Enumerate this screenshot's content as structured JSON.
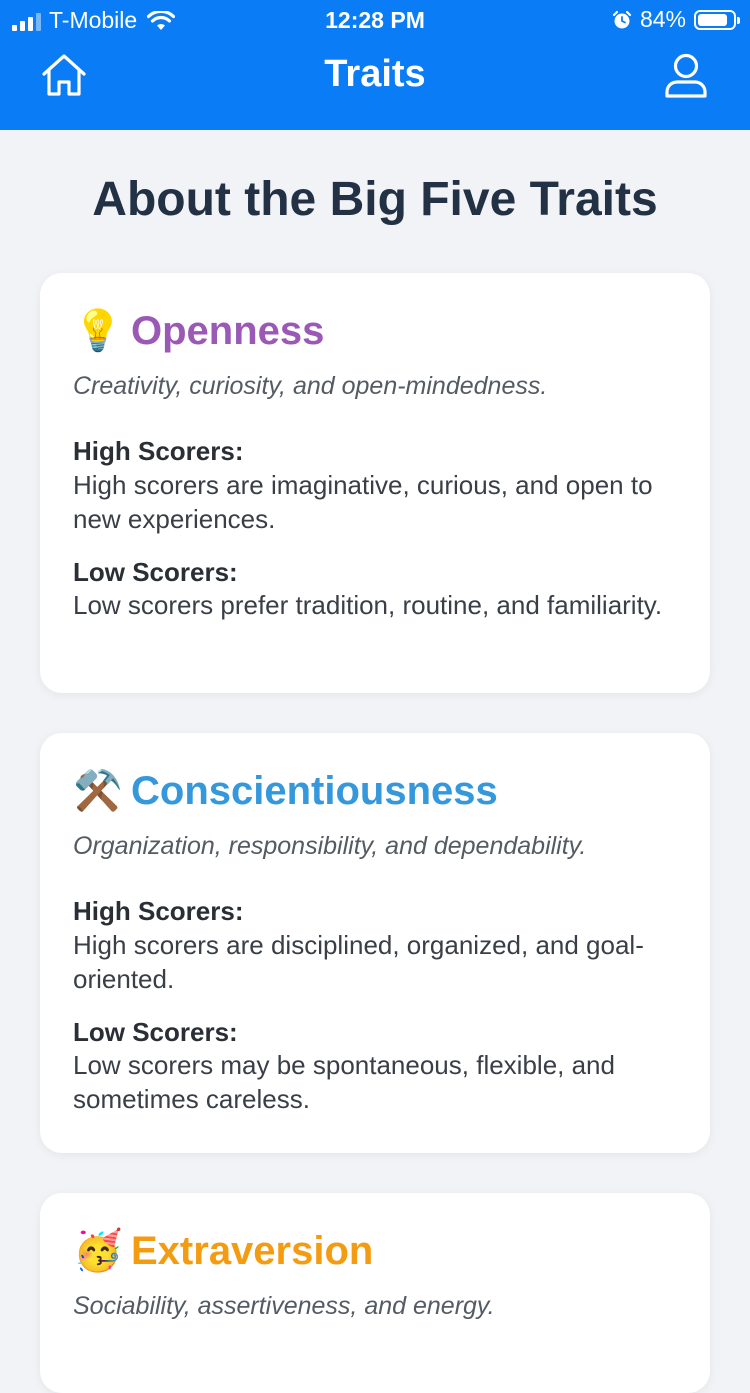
{
  "status_bar": {
    "carrier": "T-Mobile",
    "time": "12:28 PM",
    "battery": "84%",
    "battery_level": 0.84
  },
  "nav": {
    "title": "Traits",
    "home_icon": "home-icon",
    "profile_icon": "user-icon"
  },
  "page": {
    "title": "About the Big Five Traits"
  },
  "traits": [
    {
      "emoji": "💡",
      "name": "Openness",
      "color": "#9b59b6",
      "description": "Creativity, curiosity, and open-mindedness.",
      "high_label": "High Scorers:",
      "high_text": "High scorers are imaginative, curious, and open to new experiences.",
      "low_label": "Low Scorers:",
      "low_text": "Low scorers prefer tradition, routine, and familiarity."
    },
    {
      "emoji": "⚒️",
      "name": "Conscientiousness",
      "color": "#3498db",
      "description": "Organization, responsibility, and dependability.",
      "high_label": "High Scorers:",
      "high_text": "High scorers are disciplined, organized, and goal-oriented.",
      "low_label": "Low Scorers:",
      "low_text": "Low scorers may be spontaneous, flexible, and sometimes careless."
    },
    {
      "emoji": "🥳",
      "name": "Extraversion",
      "color": "#f39c12",
      "description": "Sociability, assertiveness, and energy."
    }
  ],
  "colors": {
    "header": "#0a7cf5",
    "background": "#f2f3f7",
    "title": "#223244"
  }
}
